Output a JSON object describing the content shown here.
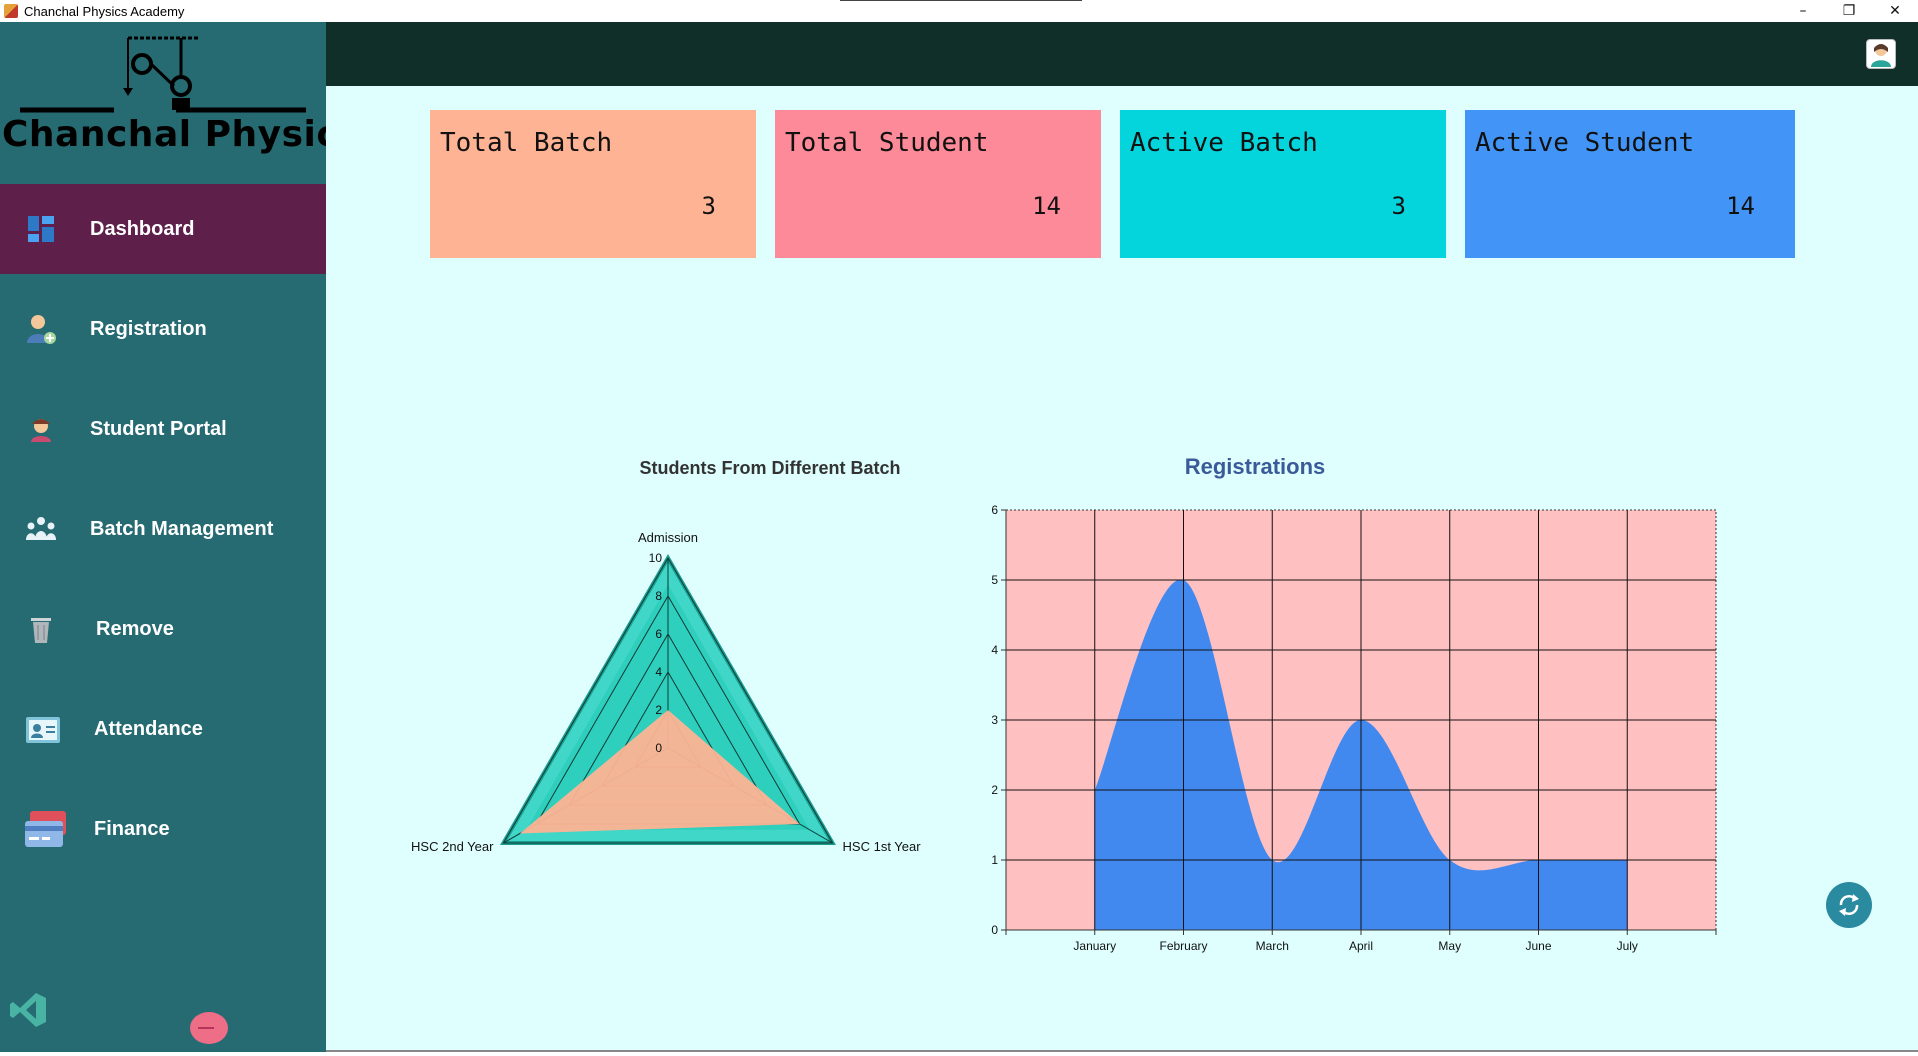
{
  "window": {
    "title": "Chanchal Physics Academy",
    "controls": [
      "–",
      "❐",
      "✕"
    ]
  },
  "sidebar": {
    "logo_text": "Chanchal Physics",
    "items": [
      {
        "label": "Dashboard",
        "icon": "dashboard-icon",
        "active": true
      },
      {
        "label": "Registration",
        "icon": "add-user-icon",
        "active": false
      },
      {
        "label": "Student Portal",
        "icon": "student-icon",
        "active": false
      },
      {
        "label": "Batch Management",
        "icon": "group-icon",
        "active": false
      },
      {
        "label": "Remove",
        "icon": "trash-icon",
        "active": false
      },
      {
        "label": "Attendance",
        "icon": "id-card-icon",
        "active": false
      },
      {
        "label": "Finance",
        "icon": "credit-card-icon",
        "active": false
      }
    ]
  },
  "cards": [
    {
      "title": "Total Batch",
      "value": "3",
      "color": "#fdb394"
    },
    {
      "title": "Total Student",
      "value": "14",
      "color": "#fd8a98"
    },
    {
      "title": "Active Batch",
      "value": "3",
      "color": "#04d4dc"
    },
    {
      "title": "Active Student",
      "value": "14",
      "color": "#4295f6"
    }
  ],
  "charts": {
    "radar_title": "Students From Different Batch",
    "area_title": "Registrations"
  },
  "chart_data": [
    {
      "type": "radar",
      "title": "Students From Different Batch",
      "axes": [
        "Admission",
        "HSC 1st Year",
        "HSC 2nd Year"
      ],
      "rlim": [
        0,
        10
      ],
      "ticks": [
        "0",
        "2",
        "4",
        "6",
        "8",
        "10"
      ],
      "series": [
        {
          "values": [
            2,
            8,
            9
          ],
          "color": "#fdb394"
        }
      ]
    },
    {
      "type": "area",
      "title": "Registrations",
      "categories": [
        "January",
        "February",
        "March",
        "April",
        "May",
        "June",
        "July"
      ],
      "values": [
        2,
        5,
        1,
        3,
        1,
        1,
        1
      ],
      "ylim": [
        0,
        6
      ],
      "yticks": [
        "0",
        "1",
        "2",
        "3",
        "4",
        "5",
        "6"
      ],
      "grid": true,
      "colors": {
        "area": "#4189ef",
        "plot_bg": "#fec0c0"
      }
    }
  ]
}
